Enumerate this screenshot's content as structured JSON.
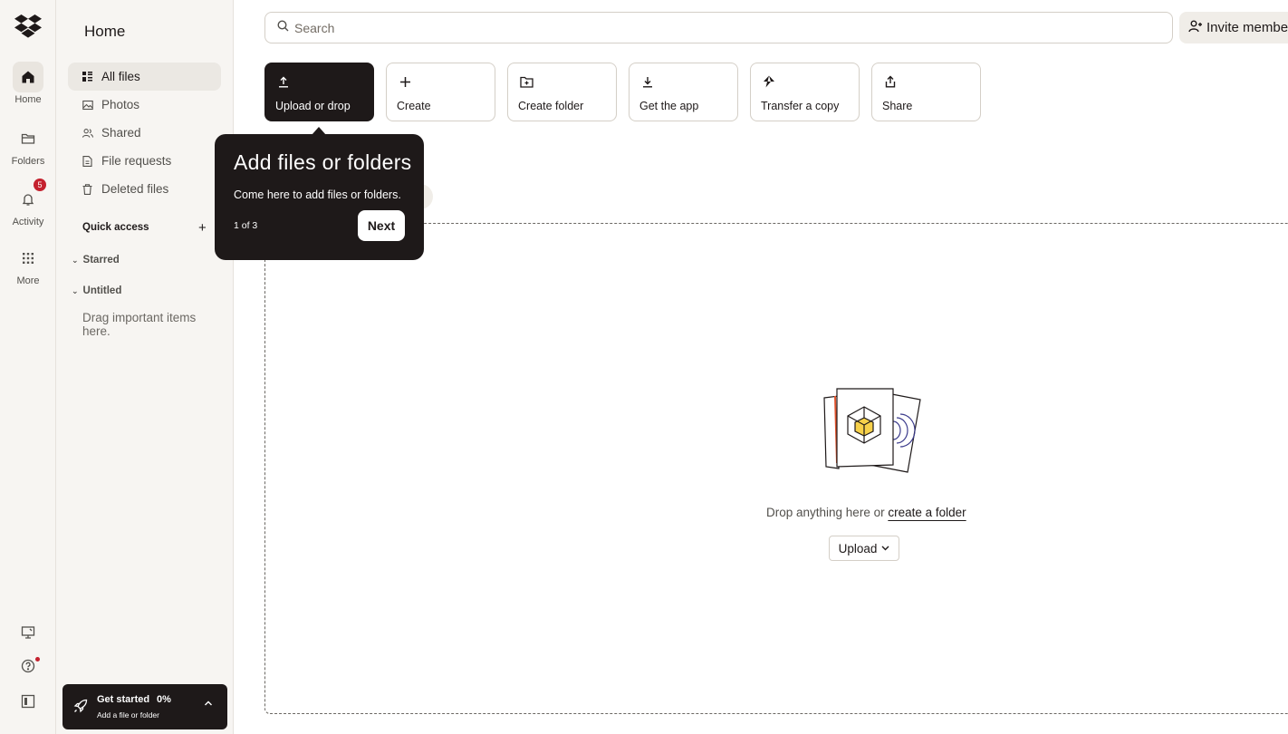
{
  "rail": {
    "items": [
      {
        "label": "Home",
        "icon": "home-icon"
      },
      {
        "label": "Folders",
        "icon": "folder-icon"
      },
      {
        "label": "Activity",
        "icon": "bell-icon",
        "badge": "5"
      },
      {
        "label": "More",
        "icon": "grid-icon"
      }
    ]
  },
  "sidebar": {
    "title": "Home",
    "items": [
      {
        "label": "All files",
        "icon": "files-icon"
      },
      {
        "label": "Photos",
        "icon": "photo-icon"
      },
      {
        "label": "Shared",
        "icon": "shared-icon"
      },
      {
        "label": "File requests",
        "icon": "file-request-icon"
      },
      {
        "label": "Deleted files",
        "icon": "trash-icon"
      }
    ],
    "quick_access": "Quick access",
    "sections": [
      "Starred",
      "Untitled"
    ],
    "drag_hint": "Drag important items here.",
    "get_started": {
      "title": "Get started",
      "progress": "0%",
      "subtitle": "Add a file or folder"
    }
  },
  "search": {
    "placeholder": "Search"
  },
  "invite_label": "Invite members",
  "actions": [
    {
      "label": "Upload or drop",
      "icon": "upload-icon"
    },
    {
      "label": "Create",
      "icon": "plus-icon"
    },
    {
      "label": "Create folder",
      "icon": "folder-plus-icon"
    },
    {
      "label": "Get the app",
      "icon": "download-icon"
    },
    {
      "label": "Transfer a copy",
      "icon": "transfer-icon"
    },
    {
      "label": "Share",
      "icon": "share-icon"
    }
  ],
  "tooltip": {
    "title": "Add files or folders",
    "body": "Come here to add files or folders.",
    "step": "1 of 3",
    "next": "Next"
  },
  "dropzone": {
    "text": "Drop anything here or",
    "link": "create a folder",
    "upload_label": "Upload"
  },
  "colors": {
    "dark": "#1e1919",
    "sidebar_bg": "#f7f5f2",
    "badge": "#c4212e",
    "accent_yellow": "#f7d14a"
  }
}
